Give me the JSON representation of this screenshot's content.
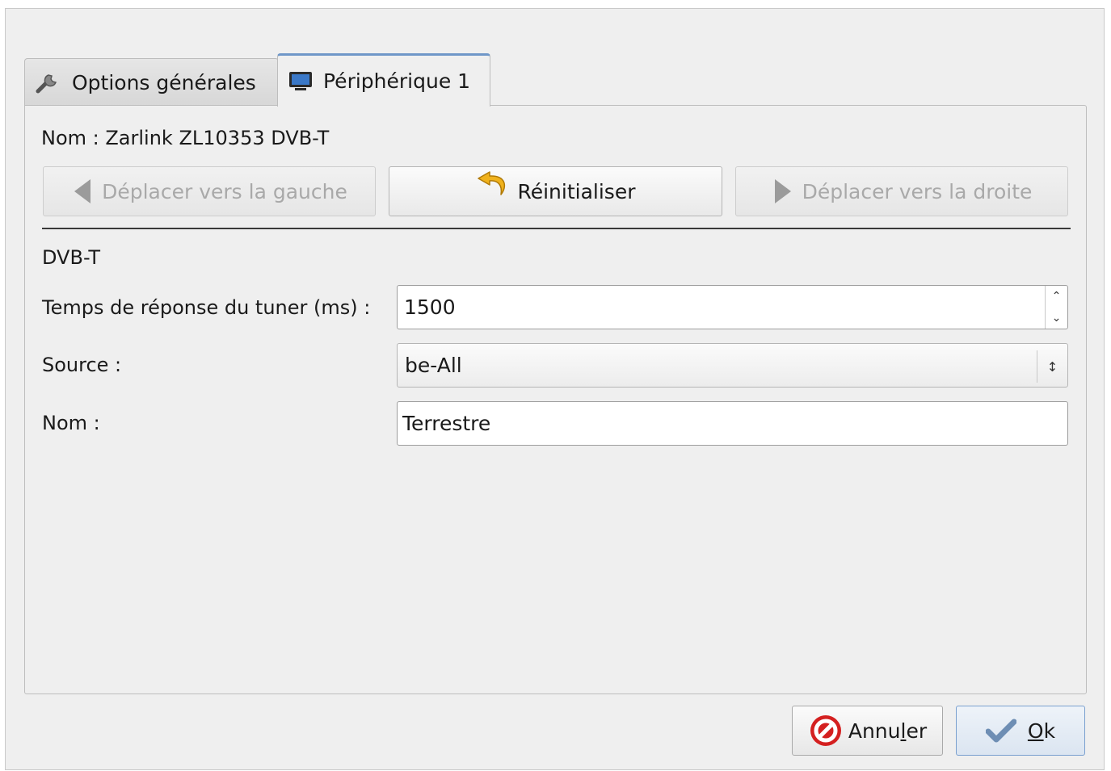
{
  "tabs": [
    {
      "label": "Options générales",
      "icon": "wrench-icon"
    },
    {
      "label": "Périphérique 1",
      "icon": "monitor-icon"
    }
  ],
  "device": {
    "name_line": "Nom : Zarlink ZL10353 DVB-T",
    "move_left_label": "Déplacer vers la gauche",
    "reset_label": "Réinitialiser",
    "move_right_label": "Déplacer vers la droite",
    "section_title": "DVB-T",
    "tuner_label": "Temps de réponse du tuner (ms) :",
    "tuner_value": "1500",
    "source_label": "Source :",
    "source_value": "be-All",
    "name_label": "Nom :",
    "name_value": "Terrestre"
  },
  "footer": {
    "cancel_pre": "Annu",
    "cancel_mnemonic": "l",
    "cancel_post": "er",
    "ok_mnemonic": "O",
    "ok_post": "k"
  },
  "colors": {
    "tab_accent": "#6f97c8",
    "cancel_icon": "#d42020",
    "reset_icon": "#f0b21c"
  }
}
